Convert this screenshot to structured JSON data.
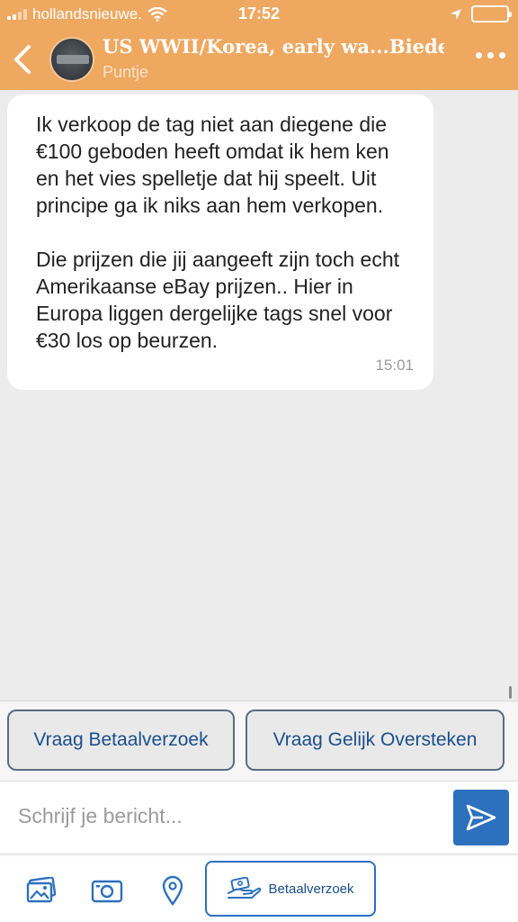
{
  "status_bar": {
    "carrier": "hollandsnieuwe.",
    "time": "17:52"
  },
  "header": {
    "title": "US WWII/Korea, early wa...Bieden",
    "subtitle": "Puntje"
  },
  "message": {
    "paragraph1": "Ik verkoop de tag niet aan diegene die €100 geboden heeft omdat ik hem ken en het vies spelletje dat hij speelt. Uit principe ga ik niks aan hem verkopen.",
    "paragraph2": "Die prijzen die jij aangeeft zijn toch echt Amerikaanse eBay prijzen.. Hier in Europa liggen dergelijke tags snel voor €30 los op beurzen.",
    "time": "15:01"
  },
  "quick_actions": {
    "request_payment": "Vraag Betaalverzoek",
    "request_split": "Vraag Gelijk Oversteken"
  },
  "composer": {
    "placeholder": "Schrijf je bericht..."
  },
  "toolbar": {
    "payment_request_label": "Betaalverzoek"
  },
  "colors": {
    "header": "#eea860",
    "accent": "#2d70be",
    "background": "#ececec"
  },
  "icons": [
    "back-icon",
    "more-icon",
    "wifi-icon",
    "location-arrow-icon",
    "battery-icon",
    "send-icon",
    "photos-icon",
    "camera-icon",
    "location-pin-icon",
    "payment-hand-icon"
  ]
}
